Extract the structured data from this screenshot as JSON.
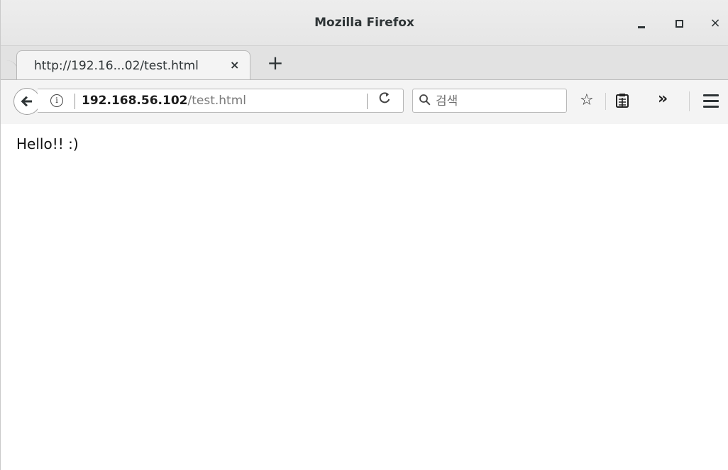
{
  "window": {
    "title": "Mozilla Firefox",
    "controls": {
      "minimize_icon": "minimize-icon",
      "maximize_icon": "maximize-icon",
      "close_label": "×"
    }
  },
  "tabs": [
    {
      "title": "http://192.16...02/test.html",
      "close_label": "×",
      "active": true
    }
  ],
  "new_tab_label": "+",
  "navbar": {
    "url_host": "192.168.56.102",
    "url_path": "/test.html",
    "info_label": "i",
    "reload_label": "C",
    "search_placeholder": "검색",
    "star_label": "☆",
    "overflow_label": "»"
  },
  "page": {
    "text": "Hello!! :)"
  }
}
